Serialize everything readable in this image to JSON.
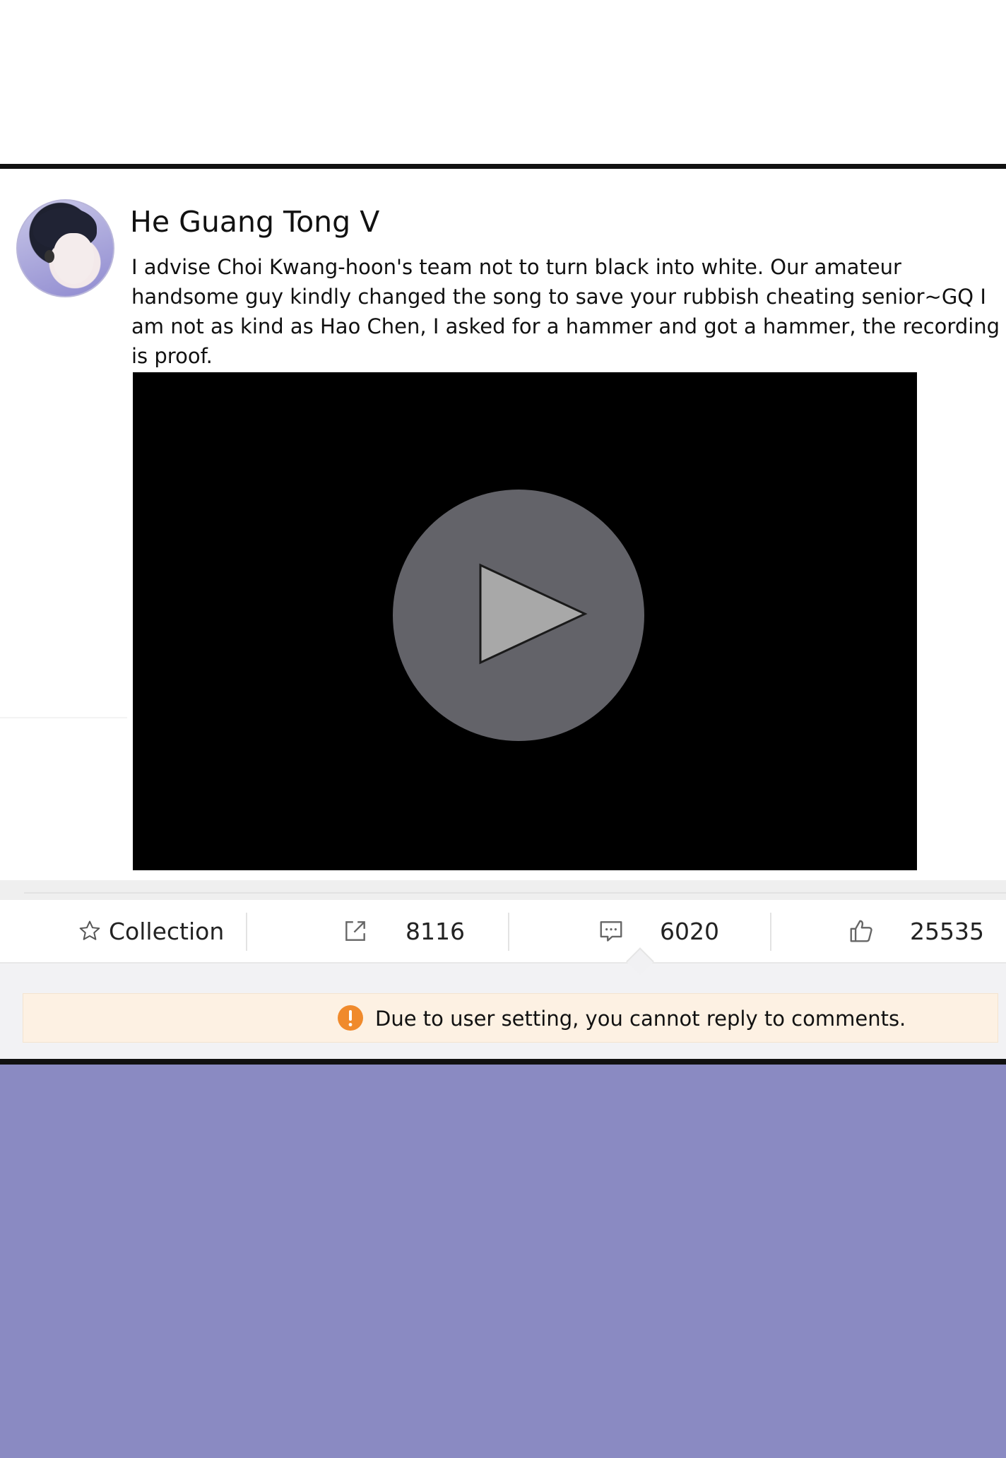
{
  "post": {
    "username": "He Guang Tong V",
    "text": "I advise Choi Kwang-hoon's team not to turn black into white. Our amateur handsome guy kindly changed the song to save your rubbish cheating senior~GQ I am not as kind as Hao Chen, I asked for a hammer and got a hammer, the recording is proof."
  },
  "actions": {
    "collection_label": "Collection",
    "share_count": "8116",
    "comment_count": "6020",
    "like_count": "25535"
  },
  "notice": {
    "text": "Due to user setting, you cannot reply to comments."
  },
  "colors": {
    "notice_bg": "#fdf1e3",
    "warning_icon": "#f08a2c",
    "bottom_panel": "#8a8ac2"
  },
  "icons": [
    "star-icon",
    "share-icon",
    "comment-icon",
    "thumbs-up-icon",
    "warning-icon",
    "play-icon"
  ]
}
